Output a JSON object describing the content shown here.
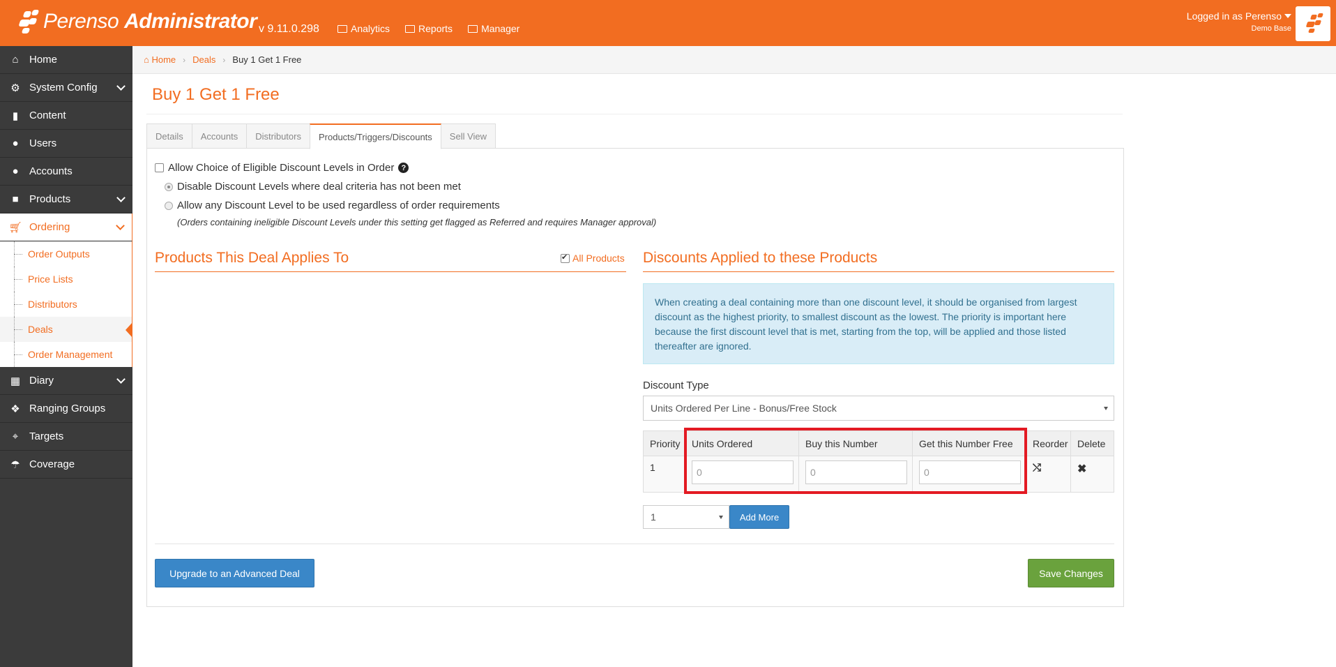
{
  "header": {
    "brand": "Perenso",
    "product": "Administrator",
    "version": "v 9.11.0.298",
    "nav": [
      {
        "label": "Analytics",
        "icon": "bar-chart-icon"
      },
      {
        "label": "Reports",
        "icon": "table-icon"
      },
      {
        "label": "Manager",
        "icon": "briefcase-icon"
      }
    ],
    "user_label": "Logged in as Perenso",
    "database": "Demo Base"
  },
  "sidebar": {
    "items": [
      {
        "label": "Home",
        "icon": "home-icon"
      },
      {
        "label": "System Config",
        "icon": "gear-icon"
      },
      {
        "label": "Content",
        "icon": "file-icon"
      },
      {
        "label": "Users",
        "icon": "user-icon"
      },
      {
        "label": "Accounts",
        "icon": "group-icon"
      },
      {
        "label": "Products",
        "icon": "gift-icon"
      },
      {
        "label": "Ordering",
        "icon": "cart-icon"
      },
      {
        "label": "Diary",
        "icon": "calendar-icon"
      },
      {
        "label": "Ranging Groups",
        "icon": "cubes-icon"
      },
      {
        "label": "Targets",
        "icon": "crosshair-icon"
      },
      {
        "label": "Coverage",
        "icon": "umbrella-icon"
      }
    ],
    "ordering_sub": [
      {
        "label": "Order Outputs"
      },
      {
        "label": "Price Lists"
      },
      {
        "label": "Distributors"
      },
      {
        "label": "Deals"
      },
      {
        "label": "Order Management"
      }
    ]
  },
  "breadcrumb": [
    "Home",
    "Deals",
    "Buy 1 Get 1 Free"
  ],
  "page": {
    "title": "Buy 1 Get 1 Free",
    "tabs": [
      "Details",
      "Accounts",
      "Distributors",
      "Products/Triggers/Discounts",
      "Sell View"
    ],
    "active_tab": "Products/Triggers/Discounts",
    "allow_choice_label": "Allow Choice of Eligible Discount Levels in Order",
    "radio1_label": "Disable Discount Levels where deal criteria has not been met",
    "radio2_label": "Allow any Discount Level to be used regardless of order requirements",
    "note": "(Orders containing ineligible Discount Levels under this setting get flagged as Referred and requires Manager approval)",
    "products_title": "Products This Deal Applies To",
    "all_products_label": "All Products",
    "discounts_title": "Discounts Applied to these Products",
    "info_text": "When creating a deal containing more than one discount level, it should be organised from largest discount as the highest priority, to smallest discount as the lowest. The priority is important here because the first discount level that is met, starting from the top, will be applied and those listed thereafter are ignored.",
    "discount_type_label": "Discount Type",
    "discount_type_value": "Units Ordered Per Line - Bonus/Free Stock",
    "table": {
      "headers": [
        "Priority",
        "Units Ordered",
        "Buy this Number",
        "Get this Number Free",
        "Reorder",
        "Delete"
      ],
      "rows": [
        {
          "priority": "1",
          "units_ordered": "0",
          "buy": "0",
          "free": "0"
        }
      ]
    },
    "add_count": "1",
    "add_more_label": "Add More",
    "upgrade_label": "Upgrade to an Advanced Deal",
    "save_label": "Save Changes"
  }
}
